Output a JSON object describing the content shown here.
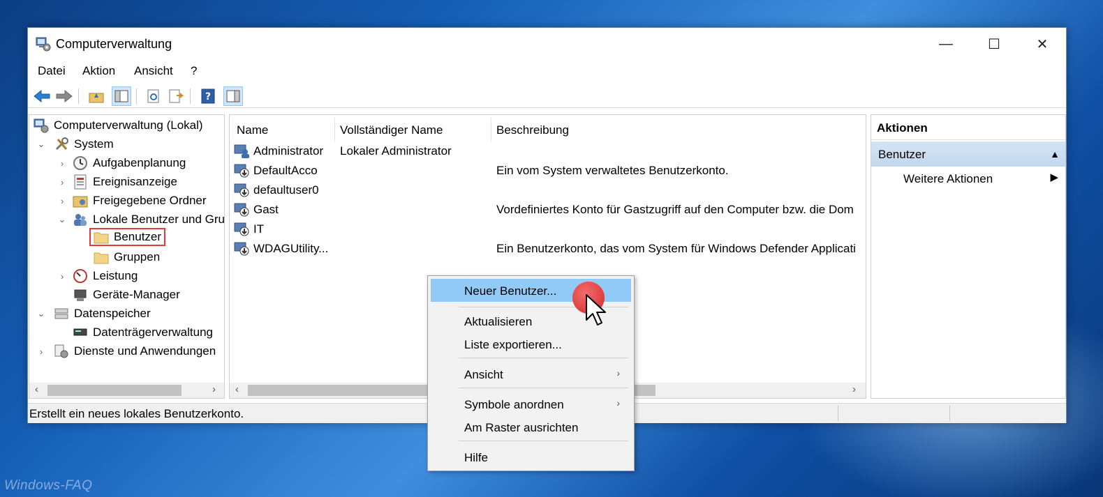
{
  "window": {
    "title": "Computerverwaltung",
    "controls": {
      "minimize": "—",
      "maximize": "☐",
      "close": "✕"
    }
  },
  "menubar": [
    "Datei",
    "Aktion",
    "Ansicht",
    "?"
  ],
  "toolbar": {
    "buttons": [
      "back-icon",
      "forward-icon",
      "up-folder-icon",
      "show-hide-console-tree-icon",
      "refresh-icon",
      "export-list-icon",
      "help-icon",
      "show-hide-action-pane-icon"
    ]
  },
  "tree": {
    "root": "Computerverwaltung (Lokal)",
    "system": "System",
    "aufgabenplanung": "Aufgabenplanung",
    "ereignisanzeige": "Ereignisanzeige",
    "freigegebene": "Freigegebene Ordner",
    "lokale": "Lokale Benutzer und Gruppen",
    "benutzer": "Benutzer",
    "gruppen": "Gruppen",
    "leistung": "Leistung",
    "geraete": "Geräte-Manager",
    "datenspeicher": "Datenspeicher",
    "datentraeger": "Datenträgerverwaltung",
    "dienste": "Dienste und Anwendungen"
  },
  "list": {
    "columns": [
      "Name",
      "Vollständiger Name",
      "Beschreibung"
    ],
    "rows": [
      [
        "Administrator",
        "Lokaler Administrator",
        ""
      ],
      [
        "DefaultAcco",
        "",
        "Ein vom System verwaltetes Benutzerkonto."
      ],
      [
        "defaultuser0",
        "",
        ""
      ],
      [
        "Gast",
        "",
        "Vordefiniertes Konto für Gastzugriff auf den Computer bzw. die Dom"
      ],
      [
        "IT",
        "",
        ""
      ],
      [
        "WDAGUtility...",
        "",
        "Ein Benutzerkonto, das vom System für Windows Defender Applicati"
      ]
    ]
  },
  "actions": {
    "title": "Aktionen",
    "section": "Benutzer",
    "item": "Weitere Aktionen"
  },
  "status": "Erstellt ein neues lokales Benutzerkonto.",
  "context_menu": {
    "new_user": "Neuer Benutzer...",
    "refresh": "Aktualisieren",
    "export": "Liste exportieren...",
    "view": "Ansicht",
    "arrange": "Symbole anordnen",
    "align": "Am Raster ausrichten",
    "help": "Hilfe"
  },
  "watermark": "Windows-FAQ",
  "colors": {
    "highlight_border": "#e3393c",
    "menu_hover": "#91c9f7",
    "action_section": "#c3d7ee"
  }
}
